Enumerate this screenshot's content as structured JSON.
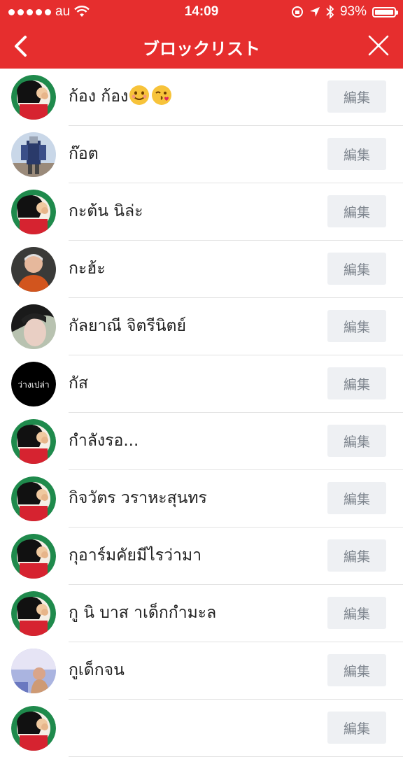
{
  "status": {
    "carrier": "au",
    "time": "14:09",
    "battery": "93%"
  },
  "nav": {
    "title": "ブロックリスト"
  },
  "edit_label": "編集",
  "contacts": [
    {
      "name": "ก้อง ก้อง",
      "avatar": "cartoon",
      "has_emoji": true
    },
    {
      "name": "ก๊อต",
      "avatar": "robot"
    },
    {
      "name": "กะต้น นิล่ะ",
      "avatar": "cartoon"
    },
    {
      "name": "กะฮ้ะ",
      "avatar": "person-orange"
    },
    {
      "name": "กัลยาณี จิตรีนิตย์",
      "avatar": "person-face"
    },
    {
      "name": "กัส",
      "avatar": "text",
      "avatar_text": "ว่างเปล่า"
    },
    {
      "name": "กำลังรอ...",
      "avatar": "cartoon"
    },
    {
      "name": "กิจวัตร วราหะสุนทร",
      "avatar": "cartoon"
    },
    {
      "name": "กุอาร์มคัยมีไรว่ามา",
      "avatar": "cartoon"
    },
    {
      "name": "กู นิ บาส าเด็กกำมะล",
      "avatar": "cartoon"
    },
    {
      "name": "กูเด็กจน",
      "avatar": "person-photo"
    },
    {
      "name": "",
      "avatar": "cartoon"
    }
  ],
  "colors": {
    "accent": "#e62e2e",
    "button_bg": "#eef0f3",
    "button_text": "#7e858e"
  }
}
